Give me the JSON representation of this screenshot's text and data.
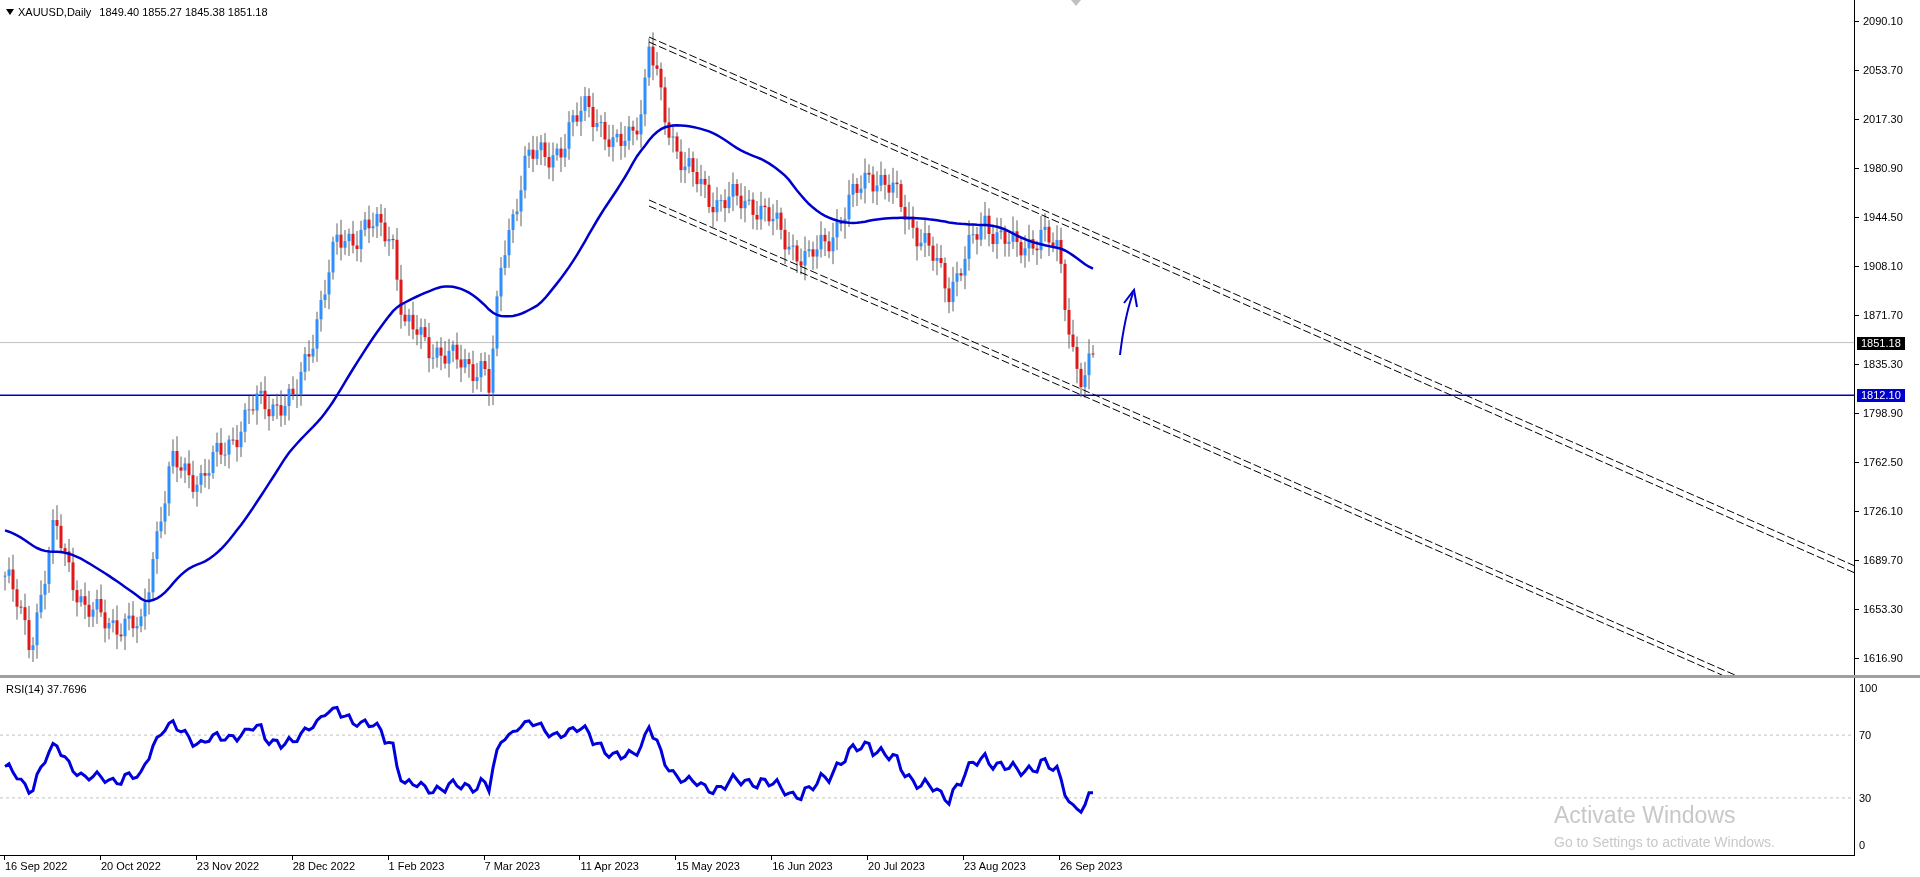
{
  "chart_header": {
    "symbol": "XAUUSD,Daily",
    "ohlc": "1849.40 1855.27 1845.38 1851.18"
  },
  "price_axis": {
    "ticks": [
      "2090.10",
      "2053.70",
      "2017.30",
      "1980.90",
      "1944.50",
      "1908.10",
      "1871.70",
      "1835.30",
      "1798.90",
      "1762.50",
      "1726.10",
      "1689.70",
      "1653.30",
      "1616.90"
    ],
    "tags": [
      {
        "kind": "current",
        "label": "1851.18"
      },
      {
        "kind": "level",
        "label": "1812.10"
      }
    ]
  },
  "indicator": {
    "label": "RSI(14) 37.7696",
    "ticks": [
      "100",
      "70",
      "30",
      "0"
    ]
  },
  "time_axis": {
    "labels": [
      "16 Sep 2022",
      "20 Oct 2022",
      "23 Nov 2022",
      "28 Dec 2022",
      "1 Feb 2023",
      "7 Mar 2023",
      "11 Apr 2023",
      "15 May 2023",
      "16 Jun 2023",
      "20 Jul 2023",
      "23 Aug 2023",
      "26 Sep 2023"
    ]
  },
  "os_watermark": {
    "title": "Activate Windows",
    "subtitle": "Go to Settings to activate Windows."
  }
}
